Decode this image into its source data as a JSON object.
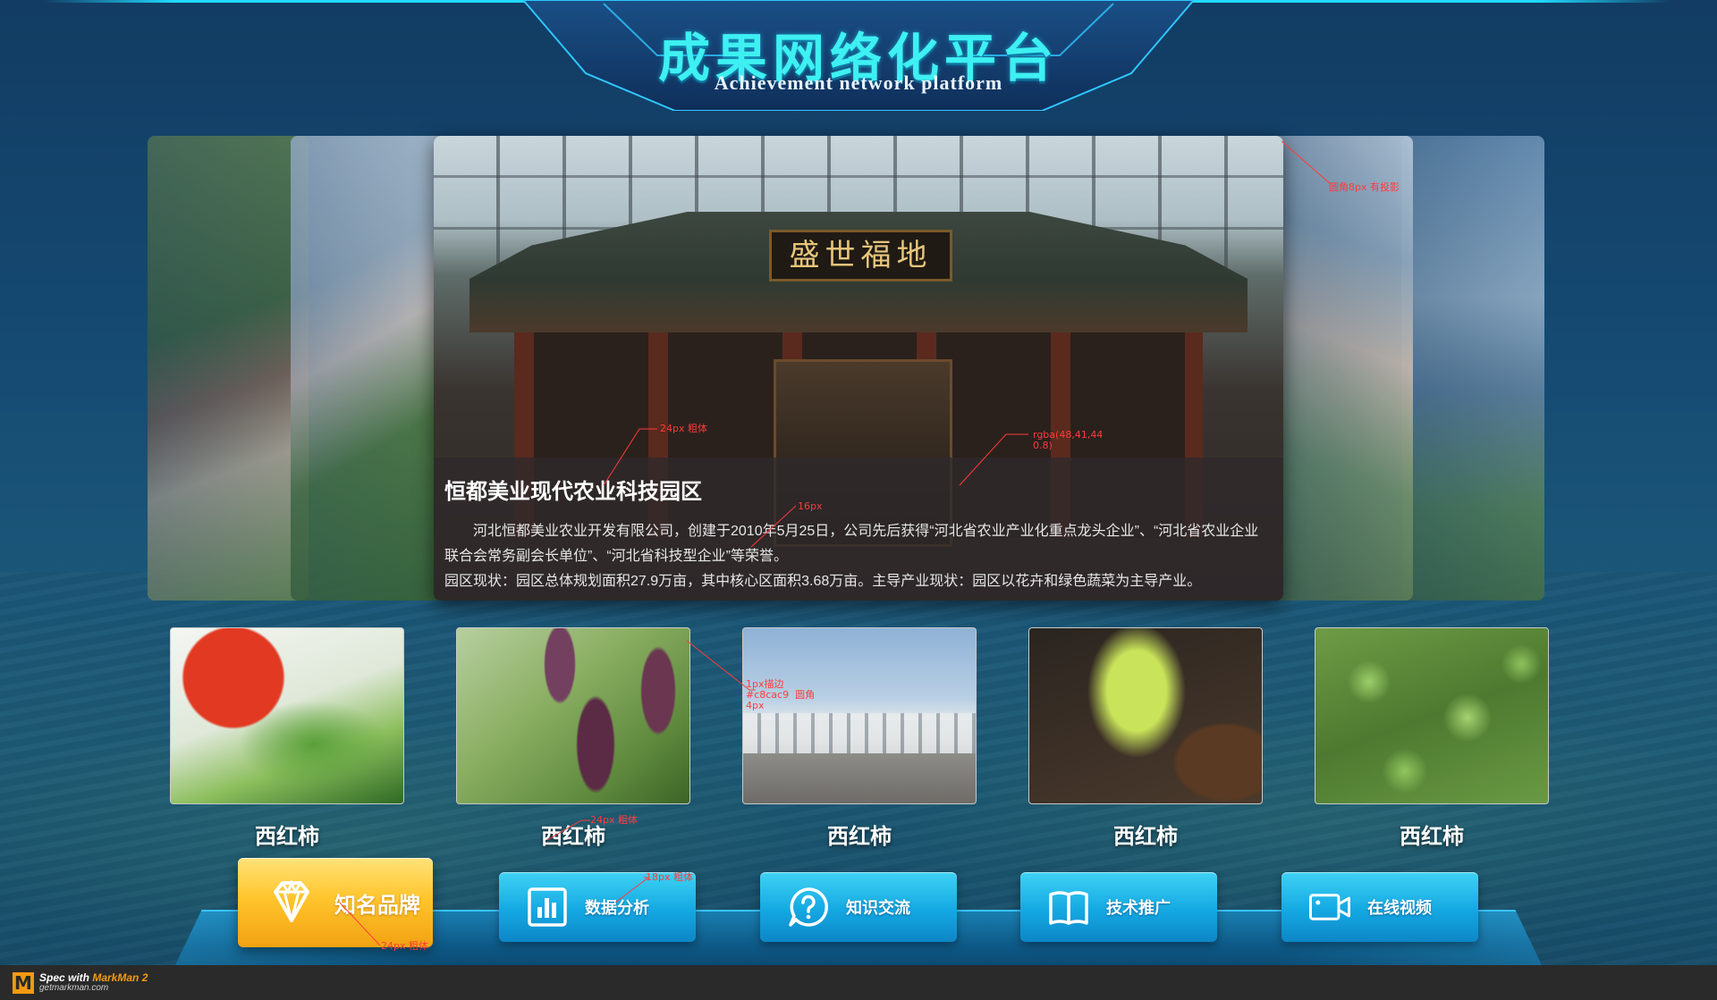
{
  "header": {
    "title": "成果网络化平台",
    "subtitle": "Achievement network platform"
  },
  "carousel": {
    "main": {
      "signboard": "盛世福地",
      "title": "恒都美业现代农业科技园区",
      "description": "河北恒都美业农业开发有限公司，创建于2010年5月25日，公司先后获得“河北省农业产业化重点龙头企业”、“河北省农业企业联合会常务副会长单位”、“河北省科技型企业”等荣誉。",
      "status": "园区现状：园区总体规划面积27.9万亩，其中核心区面积3.68万亩。主导产业现状：园区以花卉和绿色蔬菜为主导产业。"
    }
  },
  "products": [
    {
      "label": "西红柿"
    },
    {
      "label": "西红柿"
    },
    {
      "label": "西红柿"
    },
    {
      "label": "西红柿"
    },
    {
      "label": "西红柿"
    }
  ],
  "nav": [
    {
      "label": "知名品牌",
      "icon": "diamond-icon",
      "active": true
    },
    {
      "label": "数据分析",
      "icon": "bar-chart-icon",
      "active": false
    },
    {
      "label": "知识交流",
      "icon": "question-bubble-icon",
      "active": false
    },
    {
      "label": "技术推广",
      "icon": "book-icon",
      "active": false
    },
    {
      "label": "在线视频",
      "icon": "video-camera-icon",
      "active": false
    }
  ],
  "annotations": {
    "radius_shadow": "圆角8px  有投影",
    "overlay_color": "rgba(48,41,44\n0.8)",
    "title_font": "24px 粗体",
    "desc_font": "16px",
    "thumb_border": "1px描边\n#c8cac9  圆角\n4px",
    "product_font": "24px 粗体",
    "nav_font": "18px 粗体",
    "active_font": "24px 粗体"
  },
  "footer": {
    "logo": "M",
    "spec_prefix": "Spec with ",
    "spec_brand": "MarkMan 2",
    "url": "getmarkman.com"
  },
  "colors": {
    "accent_cyan": "#3ef0f2",
    "button_blue": "#14a8e2",
    "button_gold": "#ffc52c",
    "overlay": "rgba(48,41,44,0.8)",
    "thumb_border": "#c8cac9",
    "annotation_red": "#ff3b3b"
  }
}
